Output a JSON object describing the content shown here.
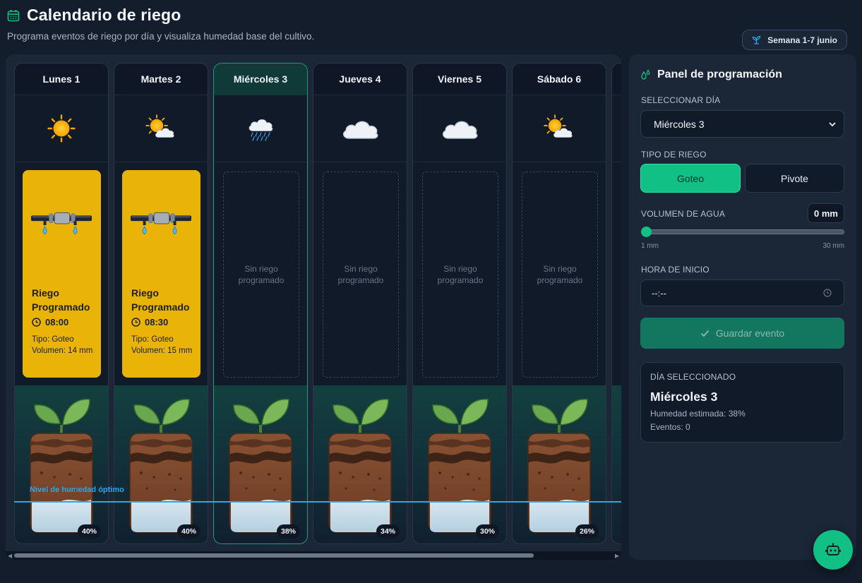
{
  "header": {
    "title": "Calendario de riego",
    "subtitle": "Programa eventos de riego por día y visualiza humedad base del cultivo.",
    "week_badge": "Semana 1-7 junio"
  },
  "calendar": {
    "optimal_label": "Nivel de humedad óptimo",
    "days": [
      {
        "name": "Lunes 1",
        "weather": "sunny",
        "moisture": "40%",
        "event": {
          "title": "Riego Programado",
          "time": "08:00",
          "type": "Tipo: Goteo",
          "volume": "Volumen: 14 mm"
        }
      },
      {
        "name": "Martes 2",
        "weather": "partly-cloudy",
        "moisture": "40%",
        "event": {
          "title": "Riego Programado",
          "time": "08:30",
          "type": "Tipo: Goteo",
          "volume": "Volumen: 15 mm"
        }
      },
      {
        "name": "Miércoles 3",
        "weather": "rain",
        "moisture": "38%",
        "empty": "Sin riego programado"
      },
      {
        "name": "Jueves 4",
        "weather": "cloudy",
        "moisture": "34%",
        "empty": "Sin riego programado"
      },
      {
        "name": "Viernes 5",
        "weather": "cloudy",
        "moisture": "30%",
        "empty": "Sin riego programado"
      },
      {
        "name": "Sábado 6",
        "weather": "partly-cloudy",
        "moisture": "26%",
        "empty": "Sin riego programado"
      }
    ]
  },
  "panel": {
    "title": "Panel de programación",
    "select_day_label": "SELECCIONAR DÍA",
    "selected_day": "Miércoles 3",
    "irrigation_type_label": "TIPO DE RIEGO",
    "type_options": [
      "Goteo",
      "Pivote"
    ],
    "volume_label": "VOLUMEN DE AGUA",
    "volume_value": "0 mm",
    "volume_min": "1 mm",
    "volume_max": "30 mm",
    "start_time_label": "HORA DE INICIO",
    "start_time_value": "--:--",
    "save_label": "Guardar evento",
    "summary": {
      "label": "DÍA SELECCIONADO",
      "day": "Miércoles 3",
      "humidity": "Humedad estimada: 38%",
      "events": "Eventos: 0"
    }
  },
  "colors": {
    "accent": "#10c084",
    "event_card": "#eab308",
    "optimal_line": "#2aa6e9",
    "background": "#141d2c"
  }
}
